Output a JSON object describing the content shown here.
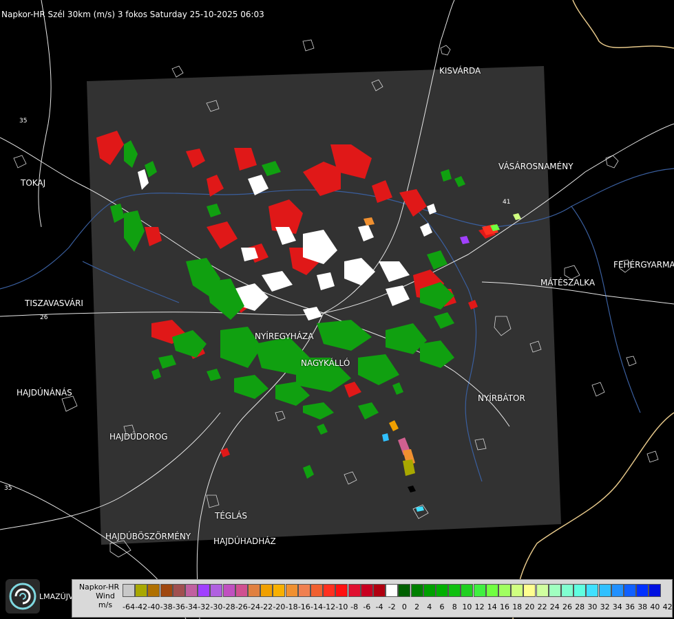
{
  "title": "Napkor-HR Szél 30km (m/s) 3 fokos Saturday 25-10-2025 06:03",
  "cities": [
    {
      "id": "kisvarda",
      "name": "KISVÁRDA"
    },
    {
      "id": "tokaj",
      "name": "TOKAJ"
    },
    {
      "id": "vasarosnameny",
      "name": "VÁSÁROSNAMÉNY"
    },
    {
      "id": "tiszavasvari",
      "name": "TISZAVASVÁRI"
    },
    {
      "id": "feheryarmat",
      "name": "FEHÉRGYARMA"
    },
    {
      "id": "mateszalka",
      "name": "MÁTÉSZALKA"
    },
    {
      "id": "nyiregyhaza",
      "name": "NYÍREGYHÁZA"
    },
    {
      "id": "nagykallo",
      "name": "NAGYKÁLLÓ"
    },
    {
      "id": "hajdunanas",
      "name": "HAJDÚNÁNÁS"
    },
    {
      "id": "nyirbator",
      "name": "NYÍRBÁTOR"
    },
    {
      "id": "hajdudorog",
      "name": "HAJDÚDOROG"
    },
    {
      "id": "teglas",
      "name": "TÉGLÁS"
    },
    {
      "id": "hajduboszormeny",
      "name": "HAJDÚBÖSZÖRMÉNY"
    },
    {
      "id": "hajduhadhaz",
      "name": "HAJDÚHADHÁZ"
    },
    {
      "id": "almazujvaros",
      "name": "LMAZÚJVÁR"
    }
  ],
  "road_numbers": [
    "35",
    "26",
    "41",
    "35"
  ],
  "legend": {
    "line1": "Napkor-HR",
    "line2": "Wind",
    "line3": "m/s",
    "ticks": [
      "-64",
      "-42",
      "-40",
      "-38",
      "-36",
      "-34",
      "-32",
      "-30",
      "-28",
      "-26",
      "-24",
      "-22",
      "-20",
      "-18",
      "-16",
      "-14",
      "-12",
      "-10",
      "-8",
      "-6",
      "-4",
      "-2",
      "0",
      "2",
      "4",
      "6",
      "8",
      "10",
      "12",
      "14",
      "16",
      "18",
      "20",
      "22",
      "24",
      "26",
      "28",
      "30",
      "32",
      "34",
      "36",
      "38",
      "40",
      "42"
    ],
    "colors": [
      "#c8c8c8",
      "#a8a800",
      "#b07000",
      "#a04810",
      "#a05050",
      "#c060a0",
      "#a040ff",
      "#b060e0",
      "#c050c0",
      "#d05090",
      "#e08040",
      "#f0a000",
      "#f8b000",
      "#f09030",
      "#f08050",
      "#f06030",
      "#ff3020",
      "#ff1010",
      "#e01030",
      "#c80020",
      "#b00010",
      "#ffffff",
      "#006000",
      "#008000",
      "#00a000",
      "#00b000",
      "#10c010",
      "#20d020",
      "#40f040",
      "#70ff40",
      "#a0ff60",
      "#d0ff80",
      "#ffff90",
      "#d0ffa0",
      "#a0ffc0",
      "#80ffd0",
      "#60ffe0",
      "#40e0ff",
      "#30c0ff",
      "#2090ff",
      "#1060ff",
      "#0030ff",
      "#0010e0"
    ]
  }
}
